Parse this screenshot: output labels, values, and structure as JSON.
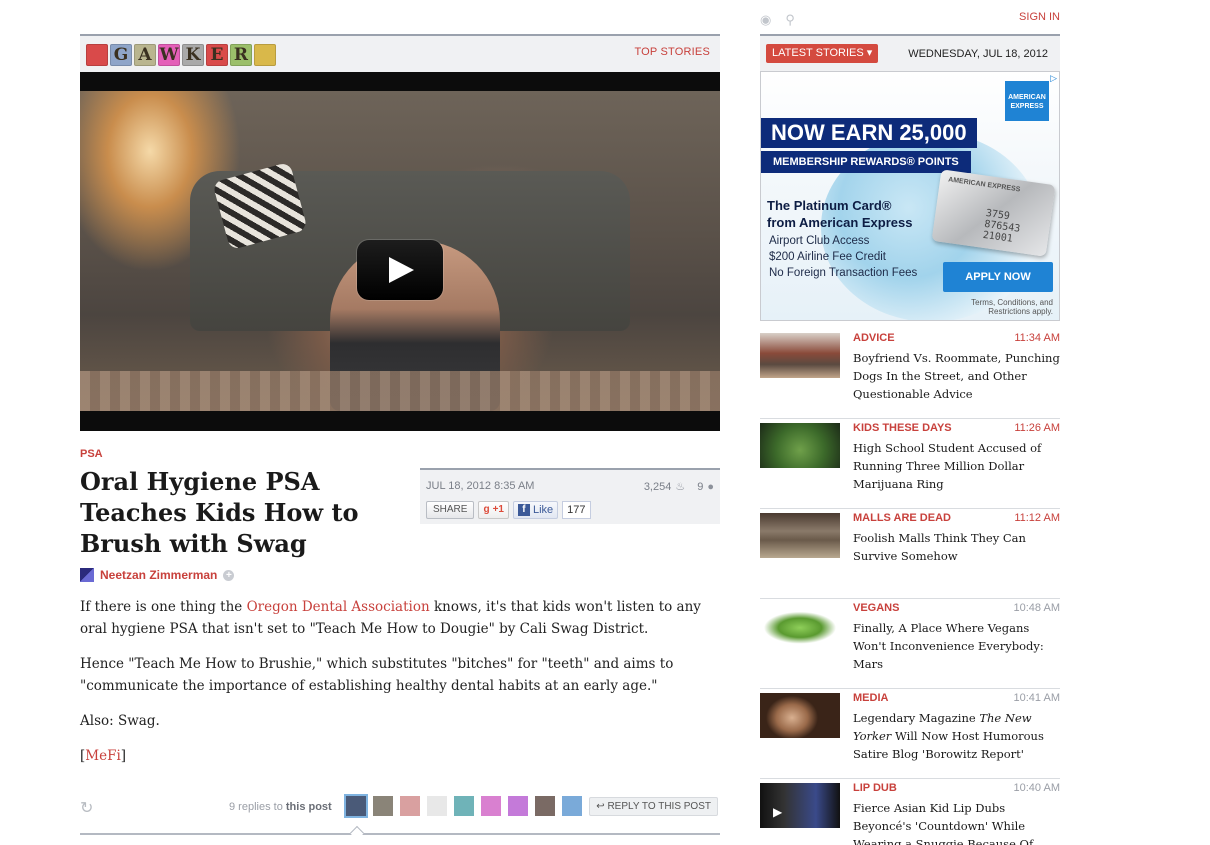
{
  "header": {
    "logo_letters": [
      "",
      "G",
      "A",
      "W",
      "K",
      "E",
      "R",
      ""
    ],
    "logo_colors": [
      "#d94a4a",
      "#8fa5c9",
      "#b9b58f",
      "#e45fb8",
      "#a9a9a9",
      "#d94a4a",
      "#9bbf6a",
      "#d9b84a"
    ],
    "top_stories": "TOP STORIES"
  },
  "article": {
    "kicker": "PSA",
    "headline": "Oral Hygiene PSA Teaches Kids How to Brush with Swag",
    "date": "JUL 18, 2012 8:35 AM",
    "views": "3,254",
    "comments": "9",
    "share_label": "SHARE",
    "gplus_label": "+1",
    "like_label": "Like",
    "like_count": "177",
    "author": "Neetzan Zimmerman",
    "p1_before": "If there is one thing the ",
    "p1_link": "Oregon Dental Association",
    "p1_after": " knows, it's that kids won't listen to any oral hygiene PSA that isn't set to \"Teach Me How to Dougie\" by Cali Swag District.",
    "p2": "Hence \"Teach Me How to Brushie,\" which substitutes \"bitches\" for \"teeth\" and aims to \"communicate the importance of establishing healthy dental habits at an early age.\"",
    "p3": "Also: Swag.",
    "p4_open": "[",
    "p4_link": "MeFi",
    "p4_close": "]"
  },
  "replies": {
    "count_text": "9 replies to",
    "this_post": "this post",
    "reply_button": "REPLY TO THIS POST",
    "avatar_colors": [
      "#4a5a78",
      "#8a8478",
      "#d9a0a0",
      "#e8e8e8",
      "#6fb3b8",
      "#d980d0",
      "#c47ad9",
      "#7a6a64",
      "#7aaad9"
    ]
  },
  "sidebar": {
    "sign_in": "SIGN IN",
    "latest_stories": "LATEST STORIES",
    "date": "WEDNESDAY, JUL 18, 2012",
    "ad": {
      "amex": "AMERICAN EXPRESS",
      "earn": "NOW EARN 25,000",
      "points": "MEMBERSHIP REWARDS® POINTS",
      "card_brand": "AMERICAN EXPRESS",
      "card_number": "3759 876543 21001",
      "platinum_1": "The Platinum Card®",
      "platinum_2": "from American Express",
      "benefit_1": "Airport Club Access",
      "benefit_2": "$200 Airline Fee Credit",
      "benefit_3": "No Foreign Transaction Fees",
      "apply": "APPLY NOW",
      "terms_1": "Terms, Conditions, and",
      "terms_2": "Restrictions apply."
    },
    "stories": [
      {
        "category": "ADVICE",
        "time": "11:34 AM",
        "title": "Boyfriend Vs. Roommate, Punching Dogs In the Street, and Other Questionable Advice"
      },
      {
        "category": "KIDS THESE DAYS",
        "time": "11:26 AM",
        "title": "High School Student Accused of Running Three Million Dollar Marijuana Ring"
      },
      {
        "category": "MALLS ARE DEAD",
        "time": "11:12 AM",
        "title": "Foolish Malls Think They Can Survive Somehow"
      },
      {
        "category": "VEGANS",
        "time": "10:48 AM",
        "title": "Finally, A Place Where Vegans Won't Inconvenience Everybody: Mars"
      },
      {
        "category": "MEDIA",
        "time": "10:41 AM",
        "title_before": "Legendary Magazine ",
        "title_italic": "The New Yorker",
        "title_after": " Will Now Host Humorous Satire Blog 'Borowitz Report'"
      },
      {
        "category": "LIP DUB",
        "time": "10:40 AM",
        "title": "Fierce Asian Kid Lip Dubs Beyoncé's 'Countdown' While Wearing a Snuggie Because Of Course"
      }
    ]
  }
}
